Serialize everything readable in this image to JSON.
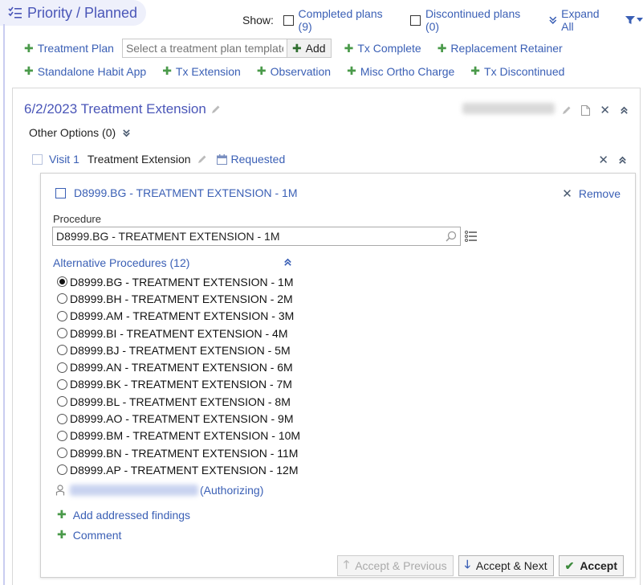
{
  "header": {
    "title": "Priority / Planned",
    "show_label": "Show:",
    "completed_plans": "Completed plans (9)",
    "discontinued_plans": "Discontinued plans (0)",
    "expand_all": "Expand All"
  },
  "toolbar": {
    "treatment_plan": "Treatment Plan",
    "template_placeholder": "Select a treatment plan template",
    "add": "Add",
    "tx_complete": "Tx Complete",
    "replacement_retainer": "Replacement Retainer",
    "standalone_habit_app": "Standalone Habit App",
    "tx_extension": "Tx Extension",
    "observation": "Observation",
    "misc_ortho_charge": "Misc Ortho Charge",
    "tx_discontinued": "Tx Discontinued"
  },
  "plan": {
    "title": "6/2/2023 Treatment Extension",
    "other_options": "Other Options (0)"
  },
  "visit": {
    "number": "Visit 1",
    "name": "Treatment Extension",
    "status": "Requested"
  },
  "procedure": {
    "header": "D8999.BG - TREATMENT EXTENSION - 1M",
    "remove": "Remove",
    "label": "Procedure",
    "value": "D8999.BG - TREATMENT EXTENSION - 1M",
    "alternatives_header": "Alternative Procedures (12)",
    "alternatives": [
      {
        "label": "D8999.BG - TREATMENT EXTENSION - 1M",
        "selected": true
      },
      {
        "label": "D8999.BH - TREATMENT EXTENSION - 2M",
        "selected": false
      },
      {
        "label": "D8999.AM - TREATMENT EXTENSION - 3M",
        "selected": false
      },
      {
        "label": "D8999.BI - TREATMENT EXTENSION - 4M",
        "selected": false
      },
      {
        "label": "D8999.BJ - TREATMENT EXTENSION - 5M",
        "selected": false
      },
      {
        "label": "D8999.AN - TREATMENT EXTENSION - 6M",
        "selected": false
      },
      {
        "label": "D8999.BK - TREATMENT EXTENSION - 7M",
        "selected": false
      },
      {
        "label": "D8999.BL - TREATMENT EXTENSION - 8M",
        "selected": false
      },
      {
        "label": "D8999.AO - TREATMENT EXTENSION - 9M",
        "selected": false
      },
      {
        "label": "D8999.BM - TREATMENT EXTENSION - 10M",
        "selected": false
      },
      {
        "label": "D8999.BN - TREATMENT EXTENSION - 11M",
        "selected": false
      },
      {
        "label": "D8999.AP - TREATMENT EXTENSION - 12M",
        "selected": false
      }
    ],
    "authorizing": "(Authorizing)",
    "add_findings": "Add addressed findings",
    "comment": "Comment"
  },
  "buttons": {
    "accept_previous": "Accept & Previous",
    "accept_next": "Accept & Next",
    "accept": "Accept"
  }
}
